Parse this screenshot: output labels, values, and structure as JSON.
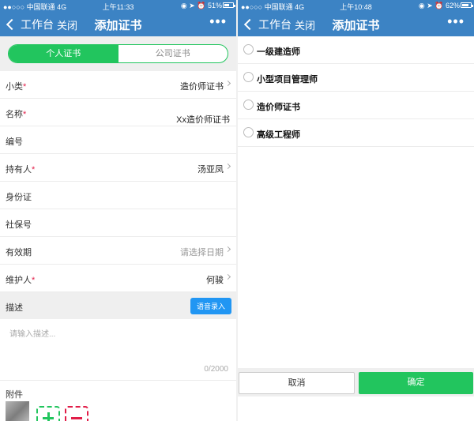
{
  "left": {
    "status": {
      "carrier": "●●○○○ 中国联通  4G",
      "time": "上午11:33",
      "right": "◉ ➤ ⏰ 51%",
      "battery_level": 0.51
    },
    "nav": {
      "back_label": "工作台",
      "close_label": "关闭",
      "title": "添加证书",
      "more_label": "•••"
    },
    "segment": {
      "active_label": "个人证书",
      "inactive_label": "公司证书"
    },
    "fields": [
      {
        "label": "小类",
        "required": "*",
        "value": "造价师证书",
        "arrow": true
      },
      {
        "label": "名称",
        "required": "*",
        "value": "Xx造价师证书",
        "arrow": false
      },
      {
        "label": "编号",
        "required": "",
        "value": "",
        "arrow": false
      },
      {
        "label": "持有人",
        "required": "*",
        "value": "汤亚凤",
        "arrow": true
      },
      {
        "label": "身份证",
        "required": "",
        "value": "",
        "arrow": false
      },
      {
        "label": "社保号",
        "required": "",
        "value": "",
        "arrow": false
      },
      {
        "label": "有效期",
        "required": "",
        "value": "请选择日期",
        "arrow": true
      },
      {
        "label": "维护人",
        "required": "*",
        "value": "何骏",
        "arrow": true
      }
    ],
    "description": {
      "label": "描述",
      "voice_button": "语音录入",
      "placeholder": "请输入描述...",
      "counter": "0/2000"
    },
    "attachment": {
      "label": "附件"
    }
  },
  "right": {
    "status": {
      "carrier": "●●○○○ 中国联通  4G",
      "time": "上午10:48",
      "right": "◉ ➤ ⏰ 62%",
      "battery_level": 0.62
    },
    "nav": {
      "back_label": "工作台",
      "close_label": "关闭",
      "title": "添加证书",
      "more_label": "•••"
    },
    "options": [
      "一级建造师",
      "小型项目管理师",
      "造价师证书",
      "高级工程师"
    ],
    "footer": {
      "cancel_label": "取消",
      "confirm_label": "确定"
    }
  }
}
